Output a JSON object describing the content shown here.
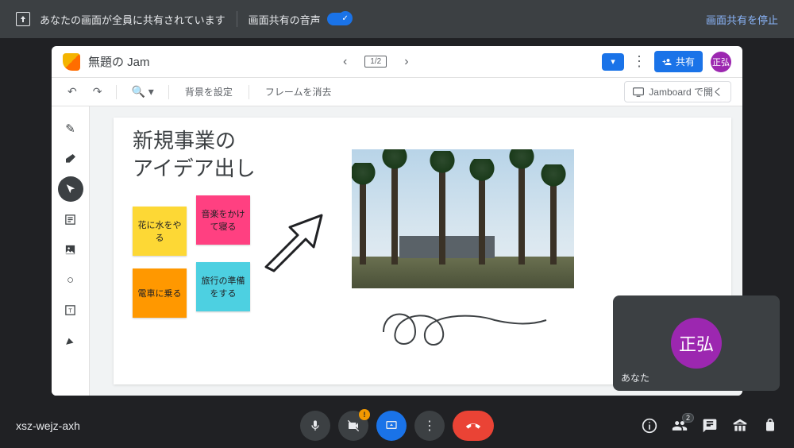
{
  "banner": {
    "share_msg": "あなたの画面が全員に共有されています",
    "audio_label": "画面共有の音声",
    "stop_label": "画面共有を停止"
  },
  "jamboard": {
    "title": "無題の Jam",
    "frame_indicator": "1/2",
    "toolbar": {
      "bg_label": "背景を設定",
      "clear_label": "フレームを消去",
      "open_label": "Jamboard で開く"
    },
    "share_button": "共有",
    "avatar_initials": "正弘",
    "canvas": {
      "heading_line1": "新規事業の",
      "heading_line2": "アイデア出し",
      "stickies": [
        {
          "text": "花に水をやる",
          "color": "#fdd835"
        },
        {
          "text": "音楽をかけて寝る",
          "color": "#ff4081"
        },
        {
          "text": "電車に乗る",
          "color": "#ff9800"
        },
        {
          "text": "旅行の準備をする",
          "color": "#4dd0e1"
        }
      ]
    }
  },
  "self_view": {
    "avatar_initials": "正弘",
    "name": "あなた"
  },
  "meet": {
    "meeting_code": "xsz-wejz-axh",
    "people_count": "2"
  }
}
